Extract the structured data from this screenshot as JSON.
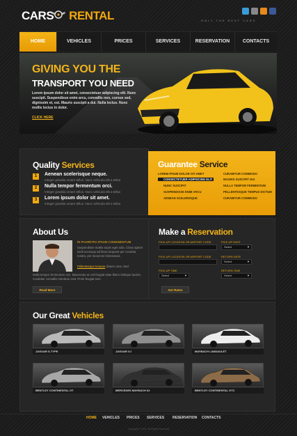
{
  "header": {
    "logo_left": "CARS",
    "logo_right": "RENTAL",
    "tagline": "ONLY THE BEST CARS"
  },
  "nav": [
    "HOME",
    "VEHICLES",
    "PRICES",
    "SERVICES",
    "RESERVATION",
    "CONTACTS"
  ],
  "hero": {
    "headline": "GIVING YOU THE",
    "subhead": "TRANSPORT YOU NEED",
    "text": "Lorem ipsum dolor sit amet, consectetuer adipiscing elit. Nunc suscipit. Suspendisse enim arcu, convallis non, cursus sed, dignissim et, est. Mauris suscipit a dui. Nulla lectus. Nunc mollis lectus in dolor.",
    "link": "CLICK HERE"
  },
  "quality": {
    "title_a": "Quality",
    "title_b": "Services",
    "items": [
      {
        "num": "1",
        "title": "Aenean scelerisque neque.",
        "sub": "Integer gravida ornare tellus. Nunc vehicula elit a tellus"
      },
      {
        "num": "2",
        "title": "Nulla tempor fermentum orci.",
        "sub": "Integer gravida ornare tellus. Nunc vehicula elit a tellus"
      },
      {
        "num": "3",
        "title": "Lorem ipsum dolor sit amet.",
        "sub": "Integer gravida ornare tellus. Nunc vehicula elit a tellus"
      }
    ]
  },
  "guarantee": {
    "title_a": "Guarantee",
    "title_b": "Service",
    "left": [
      "LOREM IPSUM DOLOR SIT AMET",
      "CONSECTETUER ADIPISCING ELIT",
      "NUNC SUSCIPIT",
      "SUSPENDISSE ENIM ARCU",
      "AENEAN SCELERISQUE"
    ],
    "right": [
      "CURABITUR COMMODO",
      "MAURIS SUSCIPIT DUI",
      "NULLA TEMPOR FERMENTUM",
      "PELLENTESQUE TEMPUS DICTUM",
      "CURABITUR COMMODO"
    ]
  },
  "about": {
    "title": "About Us",
    "highlight": "IN PHARETRA IPSUM CONDIMENTUM",
    "text1": "Suspendisse mattis turpis eget odio. Class aptent taciti sociosqu ad litora torquent per conubia nostra, per incep-tos himenaeos.",
    "link": "Pellentesque tempus",
    "text1b": "dictum urna. Sed",
    "text2": "Nulla tempor fermentum orci. Maecenas ac est feugiat vitae libero tristique lacinia. Curabitur convallis interdum erat. Proin feugiat sem",
    "button": "Read More"
  },
  "reservation": {
    "title_a": "Make a",
    "title_b": "Reservation",
    "rows": [
      {
        "left_label": "PICK-UP LOCATION OR AIRPORT CODE",
        "right_label": "PICK-UP DATE",
        "right_value": "Select"
      },
      {
        "left_label": "PICK-UP LOCATION OR AIRPORT CODE",
        "right_label": "RETURN DATE",
        "right_value": "Select"
      },
      {
        "left_label": "PICK-UP TIME",
        "left_value": "Select",
        "right_label": "RETURN TIME",
        "right_value": "Select"
      }
    ],
    "button": "Get Rates"
  },
  "vehicles": {
    "title_a": "Our Great",
    "title_b": "Vehicles",
    "items": [
      {
        "label": "JAGUAR S-TYPE",
        "color": "#b9b9b9"
      },
      {
        "label": "JAGUAR XJ",
        "color": "#8e8e8e"
      },
      {
        "label": "MAYBACH LANDAULET",
        "color": "#ededed"
      },
      {
        "label": "BENTLEY CONTINENTAL GT",
        "color": "#a7a7a7"
      },
      {
        "label": "MERCEDES MAYBACH 62",
        "color": "#303030"
      },
      {
        "label": "BENTLEY CONTINENTAL GTC",
        "color": "#8c6b48"
      }
    ]
  },
  "footer": {
    "nav": [
      "HOME",
      "VEHICLES",
      "PRICES",
      "SERVICES",
      "RESERVATION",
      "CONTACTS"
    ],
    "copyright": "Copyright © 2011. All Rights Reserved"
  },
  "colors": {
    "accent": "#f3b41a",
    "bg": "#1c1c1c",
    "panel": "#262626"
  }
}
